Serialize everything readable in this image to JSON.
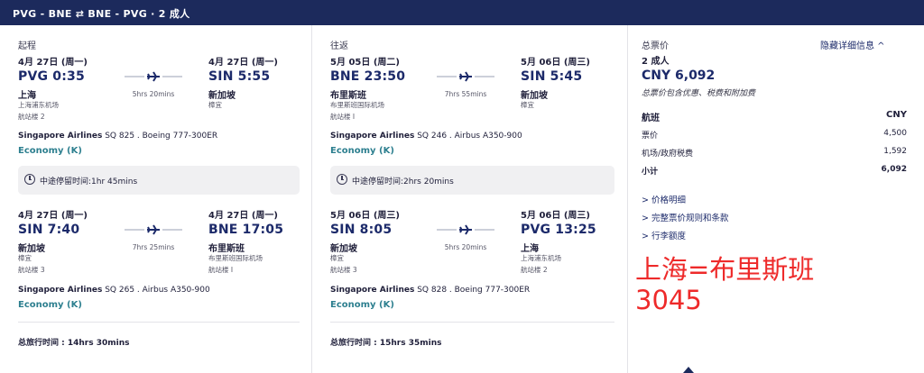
{
  "header": {
    "route": "PVG - BNE ⇄ BNE - PVG · 2 成人"
  },
  "outbound": {
    "section_label": "起程",
    "seg1": {
      "dep_date": "4月 27日 (周一)",
      "dep_time": "PVG 0:35",
      "dep_city": "上海",
      "dep_airport": "上海浦东机场",
      "dep_terminal": "航站楼 2",
      "duration": "5hrs 20mins",
      "arr_date": "4月 27日 (周一)",
      "arr_time": "SIN 5:55",
      "arr_city": "新加坡",
      "arr_airport": "樟宜",
      "airline": "Singapore Airlines",
      "flight_info": "SQ 825 . Boeing 777-300ER",
      "cabin": "Economy (K)"
    },
    "layover": "中途停留时间:1hr 45mins",
    "seg2": {
      "dep_date": "4月 27日 (周一)",
      "dep_time": "SIN 7:40",
      "dep_city": "新加坡",
      "dep_airport": "樟宜",
      "dep_terminal": "航站楼 3",
      "duration": "7hrs 25mins",
      "arr_date": "4月 27日 (周一)",
      "arr_time": "BNE 17:05",
      "arr_city": "布里斯班",
      "arr_airport": "布里斯班国际机场",
      "arr_terminal": "航站楼 I",
      "airline": "Singapore Airlines",
      "flight_info": "SQ 265 . Airbus A350-900",
      "cabin": "Economy (K)"
    },
    "total_label": "总旅行时间 : 14hrs 30mins"
  },
  "inbound": {
    "section_label": "往返",
    "seg1": {
      "dep_date": "5月 05日 (周二)",
      "dep_time": "BNE 23:50",
      "dep_city": "布里斯班",
      "dep_airport": "布里斯班国际机场",
      "dep_terminal": "航站楼 I",
      "duration": "7hrs 55mins",
      "arr_date": "5月 06日 (周三)",
      "arr_time": "SIN 5:45",
      "arr_city": "新加坡",
      "arr_airport": "樟宜",
      "airline": "Singapore Airlines",
      "flight_info": "SQ 246 . Airbus A350-900",
      "cabin": "Economy (K)"
    },
    "layover": "中途停留时间:2hrs 20mins",
    "seg2": {
      "dep_date": "5月 06日 (周三)",
      "dep_time": "SIN 8:05",
      "dep_city": "新加坡",
      "dep_airport": "樟宜",
      "dep_terminal": "航站楼 3",
      "duration": "5hrs 20mins",
      "arr_date": "5月 06日 (周三)",
      "arr_time": "PVG 13:25",
      "arr_city": "上海",
      "arr_airport": "上海浦东机场",
      "arr_terminal": "航站楼 2",
      "airline": "Singapore Airlines",
      "flight_info": "SQ 828 . Boeing 777-300ER",
      "cabin": "Economy (K)"
    },
    "total_label": "总旅行时间 : 15hrs 35mins"
  },
  "pricing": {
    "title": "总票价",
    "hide_details": "隐藏详细信息 ^",
    "passengers": "2 成人",
    "total_price": "CNY 6,092",
    "note": "总票价包含优惠、税费和附加费",
    "flight_label": "航班",
    "currency": "CNY",
    "fare_label": "票价",
    "fare_value": "4,500",
    "tax_label": "机场/政府税费",
    "tax_value": "1,592",
    "subtotal_label": "小计",
    "subtotal_value": "6,092",
    "links": [
      "> 价格明细",
      "> 完整票价规则和条款",
      "> 行李额度"
    ]
  },
  "annotation": {
    "line1": "上海=布里斯班",
    "line2": "3045"
  }
}
